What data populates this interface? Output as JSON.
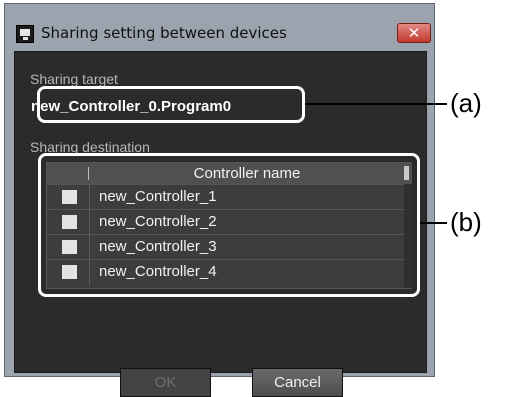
{
  "window": {
    "title": "Sharing setting between devices",
    "close_label": "✕"
  },
  "sharing_target": {
    "label": "Sharing target",
    "value": "new_Controller_0.Program0"
  },
  "sharing_destination": {
    "label": "Sharing destination",
    "column_header": "Controller name",
    "rows": [
      {
        "name": "new_Controller_1",
        "checked": false
      },
      {
        "name": "new_Controller_2",
        "checked": false
      },
      {
        "name": "new_Controller_3",
        "checked": false
      },
      {
        "name": "new_Controller_4",
        "checked": false
      }
    ]
  },
  "buttons": {
    "ok": "OK",
    "cancel": "Cancel"
  },
  "annotations": {
    "a": "(a)",
    "b": "(b)"
  },
  "colors": {
    "dialog_background": "#2b2b2b",
    "window_frame": "#9aa3ae",
    "close_button": "#c0392f",
    "callout": "#ffffff"
  }
}
